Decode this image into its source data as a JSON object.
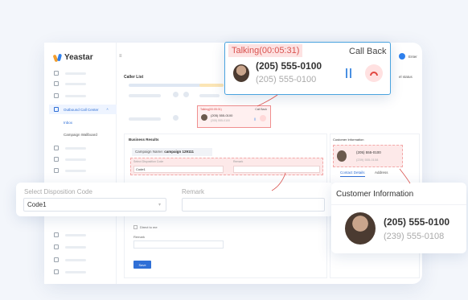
{
  "app": {
    "logo": "Yeastar",
    "user": "Enter"
  },
  "sidebar": {
    "active_item": "Outbound Call Center",
    "sub_items": [
      "Inbox",
      "Campaign Wallboard"
    ]
  },
  "main": {
    "caller_list_title": "Caller List",
    "status_select": "el status",
    "mini_call": {
      "status": "Talking(00:05:31)",
      "callback": "Call Back",
      "number_primary": "(205) 555-0100",
      "number_secondary": "(205) 555-0100"
    }
  },
  "business": {
    "title": "Business Results",
    "campaign_label": "Campaign Name:",
    "campaign_value": "campaign 129111",
    "disp_label_small": "Select Disposition Code",
    "remark_label_small": "Remark",
    "disp_value_small": "Code1",
    "direct_checkbox": "Direct to me",
    "remark_label": "Remark",
    "save_label": "Save"
  },
  "customer": {
    "title_small": "Customer Information",
    "number_primary_small": "(205) 555-0100",
    "number_secondary_small": "(239) 555-0108",
    "tab_contact": "Contact Details",
    "tab_address": "Address"
  },
  "callout_talk": {
    "status": "Talking(00:05:31)",
    "callback": "Call Back",
    "number_primary": "(205) 555-0100",
    "number_secondary": "(205) 555-0100"
  },
  "callout_disposition": {
    "label": "Select Disposition Code",
    "value": "Code1",
    "remark_label": "Remark"
  },
  "callout_customer": {
    "title": "Customer Information",
    "number_primary": "(205) 555-0100",
    "number_secondary": "(239) 555-0108"
  }
}
